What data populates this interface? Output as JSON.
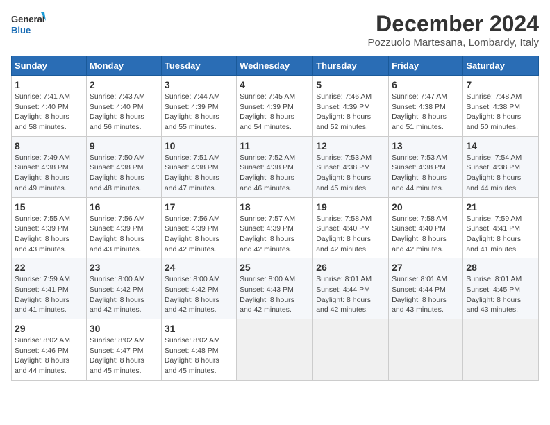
{
  "header": {
    "logo_line1": "General",
    "logo_line2": "Blue",
    "month": "December 2024",
    "location": "Pozzuolo Martesana, Lombardy, Italy"
  },
  "weekdays": [
    "Sunday",
    "Monday",
    "Tuesday",
    "Wednesday",
    "Thursday",
    "Friday",
    "Saturday"
  ],
  "weeks": [
    [
      {
        "day": 1,
        "info": "Sunrise: 7:41 AM\nSunset: 4:40 PM\nDaylight: 8 hours\nand 58 minutes."
      },
      {
        "day": 2,
        "info": "Sunrise: 7:43 AM\nSunset: 4:40 PM\nDaylight: 8 hours\nand 56 minutes."
      },
      {
        "day": 3,
        "info": "Sunrise: 7:44 AM\nSunset: 4:39 PM\nDaylight: 8 hours\nand 55 minutes."
      },
      {
        "day": 4,
        "info": "Sunrise: 7:45 AM\nSunset: 4:39 PM\nDaylight: 8 hours\nand 54 minutes."
      },
      {
        "day": 5,
        "info": "Sunrise: 7:46 AM\nSunset: 4:39 PM\nDaylight: 8 hours\nand 52 minutes."
      },
      {
        "day": 6,
        "info": "Sunrise: 7:47 AM\nSunset: 4:38 PM\nDaylight: 8 hours\nand 51 minutes."
      },
      {
        "day": 7,
        "info": "Sunrise: 7:48 AM\nSunset: 4:38 PM\nDaylight: 8 hours\nand 50 minutes."
      }
    ],
    [
      {
        "day": 8,
        "info": "Sunrise: 7:49 AM\nSunset: 4:38 PM\nDaylight: 8 hours\nand 49 minutes."
      },
      {
        "day": 9,
        "info": "Sunrise: 7:50 AM\nSunset: 4:38 PM\nDaylight: 8 hours\nand 48 minutes."
      },
      {
        "day": 10,
        "info": "Sunrise: 7:51 AM\nSunset: 4:38 PM\nDaylight: 8 hours\nand 47 minutes."
      },
      {
        "day": 11,
        "info": "Sunrise: 7:52 AM\nSunset: 4:38 PM\nDaylight: 8 hours\nand 46 minutes."
      },
      {
        "day": 12,
        "info": "Sunrise: 7:53 AM\nSunset: 4:38 PM\nDaylight: 8 hours\nand 45 minutes."
      },
      {
        "day": 13,
        "info": "Sunrise: 7:53 AM\nSunset: 4:38 PM\nDaylight: 8 hours\nand 44 minutes."
      },
      {
        "day": 14,
        "info": "Sunrise: 7:54 AM\nSunset: 4:38 PM\nDaylight: 8 hours\nand 44 minutes."
      }
    ],
    [
      {
        "day": 15,
        "info": "Sunrise: 7:55 AM\nSunset: 4:39 PM\nDaylight: 8 hours\nand 43 minutes."
      },
      {
        "day": 16,
        "info": "Sunrise: 7:56 AM\nSunset: 4:39 PM\nDaylight: 8 hours\nand 43 minutes."
      },
      {
        "day": 17,
        "info": "Sunrise: 7:56 AM\nSunset: 4:39 PM\nDaylight: 8 hours\nand 42 minutes."
      },
      {
        "day": 18,
        "info": "Sunrise: 7:57 AM\nSunset: 4:39 PM\nDaylight: 8 hours\nand 42 minutes."
      },
      {
        "day": 19,
        "info": "Sunrise: 7:58 AM\nSunset: 4:40 PM\nDaylight: 8 hours\nand 42 minutes."
      },
      {
        "day": 20,
        "info": "Sunrise: 7:58 AM\nSunset: 4:40 PM\nDaylight: 8 hours\nand 42 minutes."
      },
      {
        "day": 21,
        "info": "Sunrise: 7:59 AM\nSunset: 4:41 PM\nDaylight: 8 hours\nand 41 minutes."
      }
    ],
    [
      {
        "day": 22,
        "info": "Sunrise: 7:59 AM\nSunset: 4:41 PM\nDaylight: 8 hours\nand 41 minutes."
      },
      {
        "day": 23,
        "info": "Sunrise: 8:00 AM\nSunset: 4:42 PM\nDaylight: 8 hours\nand 42 minutes."
      },
      {
        "day": 24,
        "info": "Sunrise: 8:00 AM\nSunset: 4:42 PM\nDaylight: 8 hours\nand 42 minutes."
      },
      {
        "day": 25,
        "info": "Sunrise: 8:00 AM\nSunset: 4:43 PM\nDaylight: 8 hours\nand 42 minutes."
      },
      {
        "day": 26,
        "info": "Sunrise: 8:01 AM\nSunset: 4:44 PM\nDaylight: 8 hours\nand 42 minutes."
      },
      {
        "day": 27,
        "info": "Sunrise: 8:01 AM\nSunset: 4:44 PM\nDaylight: 8 hours\nand 43 minutes."
      },
      {
        "day": 28,
        "info": "Sunrise: 8:01 AM\nSunset: 4:45 PM\nDaylight: 8 hours\nand 43 minutes."
      }
    ],
    [
      {
        "day": 29,
        "info": "Sunrise: 8:02 AM\nSunset: 4:46 PM\nDaylight: 8 hours\nand 44 minutes."
      },
      {
        "day": 30,
        "info": "Sunrise: 8:02 AM\nSunset: 4:47 PM\nDaylight: 8 hours\nand 45 minutes."
      },
      {
        "day": 31,
        "info": "Sunrise: 8:02 AM\nSunset: 4:48 PM\nDaylight: 8 hours\nand 45 minutes."
      },
      null,
      null,
      null,
      null
    ]
  ]
}
